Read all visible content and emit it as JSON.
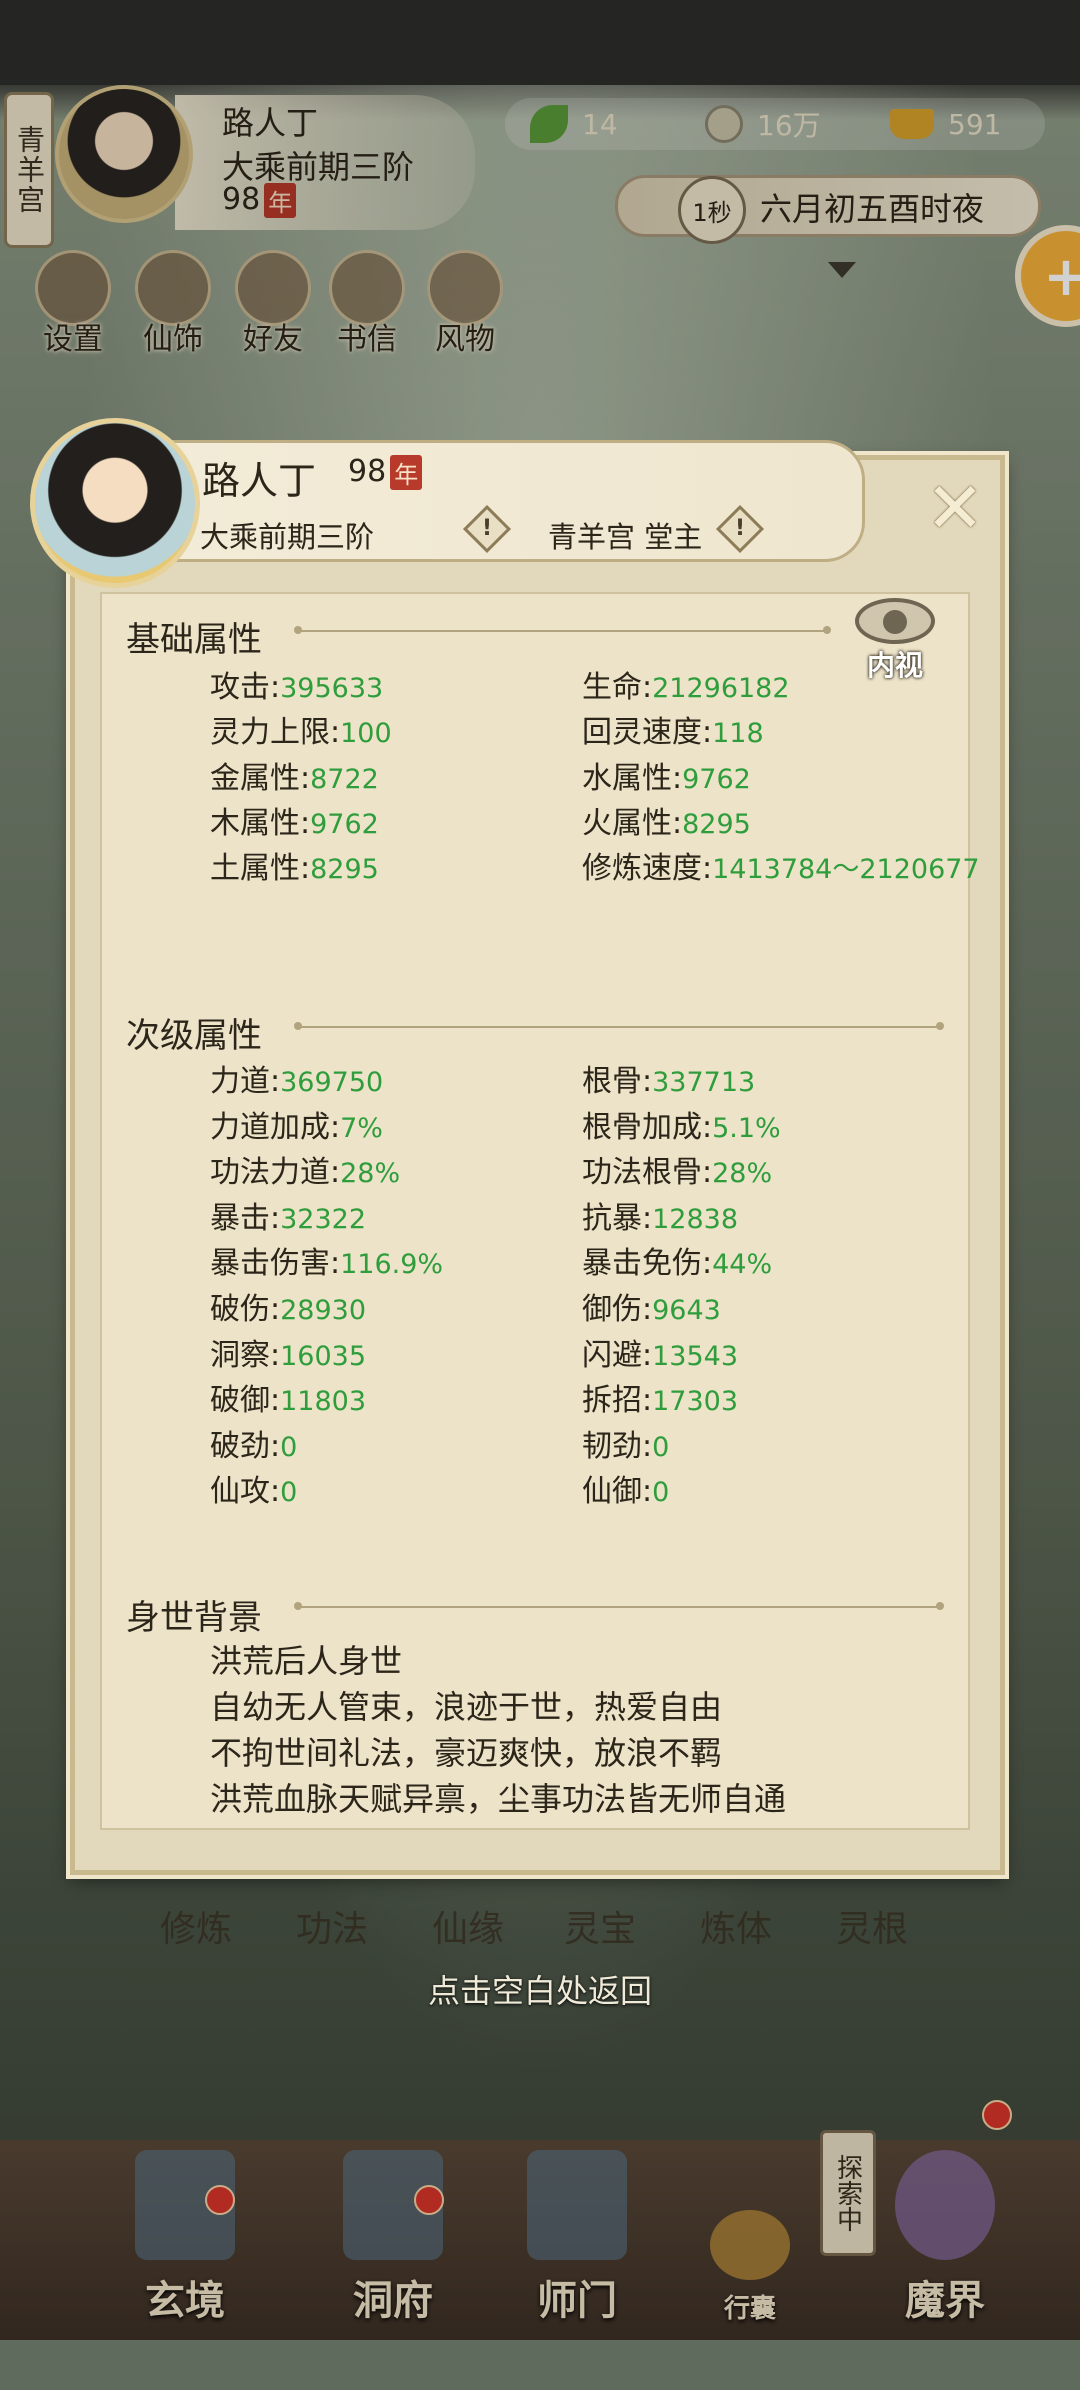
{
  "hud": {
    "sect_tag": "青羊宫",
    "player_name": "路人丁",
    "realm": "大乘前期三阶",
    "age": "98",
    "age_unit": "年",
    "res_jade": "14",
    "res_coin": "16万",
    "res_ingot": "591",
    "time_speed": "1秒",
    "time_text": "六月初五酉时夜",
    "menu": [
      "设置",
      "仙饰",
      "好友",
      "书信",
      "风物"
    ]
  },
  "panel": {
    "name": "路人丁",
    "age": "98",
    "age_unit": "年",
    "realm": "大乘前期三阶",
    "sect": "青羊宫 堂主",
    "info_mark": "!",
    "eye_label": "内视",
    "basic_title": "基础属性",
    "basic": [
      {
        "label": "攻击",
        "value": "395633"
      },
      {
        "label": "生命",
        "value": "21296182"
      },
      {
        "label": "灵力上限",
        "value": "100"
      },
      {
        "label": "回灵速度",
        "value": "118"
      },
      {
        "label": "金属性",
        "value": "8722"
      },
      {
        "label": "水属性",
        "value": "9762"
      },
      {
        "label": "木属性",
        "value": "9762"
      },
      {
        "label": "火属性",
        "value": "8295"
      },
      {
        "label": "土属性",
        "value": "8295"
      },
      {
        "label": "修炼速度",
        "value": "1413784～2120677"
      }
    ],
    "secondary_title": "次级属性",
    "secondary": [
      {
        "label": "力道",
        "value": "369750"
      },
      {
        "label": "根骨",
        "value": "337713"
      },
      {
        "label": "力道加成",
        "value": "7%"
      },
      {
        "label": "根骨加成",
        "value": "5.1%"
      },
      {
        "label": "功法力道",
        "value": "28%"
      },
      {
        "label": "功法根骨",
        "value": "28%"
      },
      {
        "label": "暴击",
        "value": "32322"
      },
      {
        "label": "抗暴",
        "value": "12838"
      },
      {
        "label": "暴击伤害",
        "value": "116.9%"
      },
      {
        "label": "暴击免伤",
        "value": "44%"
      },
      {
        "label": "破伤",
        "value": "28930"
      },
      {
        "label": "御伤",
        "value": "9643"
      },
      {
        "label": "洞察",
        "value": "16035"
      },
      {
        "label": "闪避",
        "value": "13543"
      },
      {
        "label": "破御",
        "value": "11803"
      },
      {
        "label": "拆招",
        "value": "17303"
      },
      {
        "label": "破劲",
        "value": "0"
      },
      {
        "label": "韧劲",
        "value": "0"
      },
      {
        "label": "仙攻",
        "value": "0"
      },
      {
        "label": "仙御",
        "value": "0"
      }
    ],
    "background_title": "身世背景",
    "background": [
      "洪荒后人身世",
      "自幼无人管束，浪迹于世，热爱自由",
      "不拘世间礼法，豪迈爽快，放浪不羁",
      "洪荒血脉天赋异禀，尘事功法皆无师自通"
    ]
  },
  "behind_menu": [
    "修炼",
    "功法",
    "仙缘",
    "灵宝",
    "炼体",
    "灵根"
  ],
  "hint": "点击空白处返回",
  "bottom_nav": [
    "玄境",
    "洞府",
    "师门",
    "行囊",
    "魔界"
  ],
  "explore_label": "探索中",
  "colors": {
    "stat_value": "#2f9d3c",
    "badge_red": "#b73a2a",
    "accent_orange": "#f6b03a"
  }
}
